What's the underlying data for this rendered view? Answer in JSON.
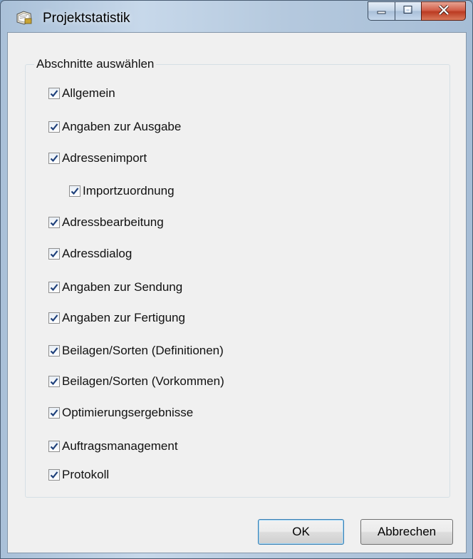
{
  "window": {
    "title": "Projektstatistik",
    "icon": "project-statistics-icon"
  },
  "caption_buttons": {
    "minimize_icon": "minimize-icon",
    "maximize_icon": "maximize-icon",
    "close_icon": "close-icon"
  },
  "group": {
    "label": "Abschnitte auswählen",
    "items": [
      {
        "label": "Allgemein",
        "checked": true
      },
      {
        "label": "Angaben zur Ausgabe",
        "checked": true
      },
      {
        "label": "Adressenimport",
        "checked": true
      },
      {
        "label": "Importzuordnung",
        "checked": true,
        "indent": 1
      },
      {
        "label": "Adressbearbeitung",
        "checked": true
      },
      {
        "label": "Adressdialog",
        "checked": true
      },
      {
        "label": "Angaben zur Sendung",
        "checked": true
      },
      {
        "label": "Angaben zur Fertigung",
        "checked": true
      },
      {
        "label": "Beilagen/Sorten (Definitionen)",
        "checked": true
      },
      {
        "label": "Beilagen/Sorten (Vorkommen)",
        "checked": true
      },
      {
        "label": "Optimierungsergebnisse",
        "checked": true
      },
      {
        "label": "Auftragsmanagement",
        "checked": true
      },
      {
        "label": "Protokoll",
        "checked": true
      }
    ]
  },
  "buttons": {
    "ok": "OK",
    "cancel": "Abbrechen"
  },
  "colors": {
    "dialog_background": "#f0f0f0",
    "checkmark": "#1d3f7a",
    "close_button": "#c8442b",
    "default_button_border": "#3c7fb1"
  }
}
